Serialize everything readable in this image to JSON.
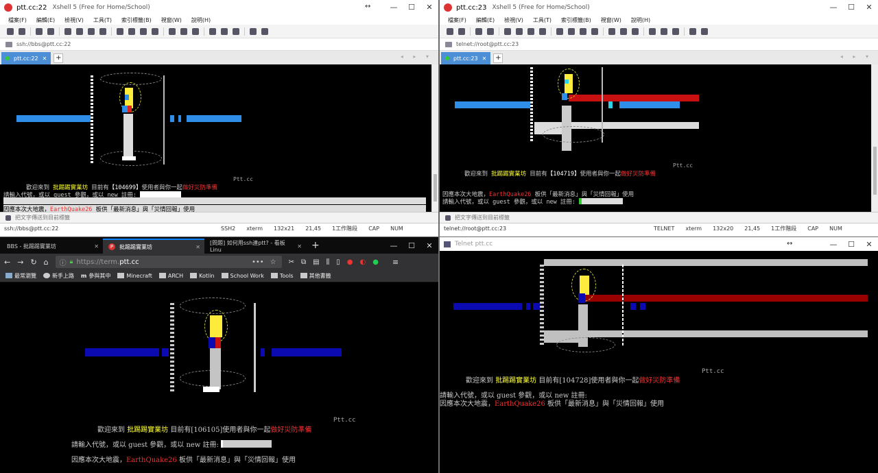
{
  "xshell": {
    "app_name": "Xshell 5 (Free for Home/School)",
    "menu": [
      "檔案(F)",
      "編輯(E)",
      "檢視(V)",
      "工具(T)",
      "索引標籤(B)",
      "視窗(W)",
      "說明(H)"
    ],
    "compose_placeholder": "把文字傳送到目前標籤",
    "left": {
      "title": "ptt.cc:22",
      "address": "ssh://bbs@ptt.cc:22",
      "tab": "ptt.cc:22",
      "welcome_pre": "歡迎來到",
      "site_name": "批踢踢實業坊",
      "welcome_mid": "目前有",
      "user_count": "【104699】",
      "welcome_post": "使用者與你一起",
      "disaster": "做好災防準備",
      "ptt_logo": "Ptt.cc",
      "login_prompt": "請輸入代號，或以 guest 參觀，或以 new 註冊:",
      "notice_pre": "因應本次大地震，",
      "quake_board": "EarthQuake26",
      "notice_post": "板供「最新消息」與「災情回報」使用",
      "status": {
        "addr": "ssh://bbs@ptt.cc:22",
        "proto": "SSH2",
        "term": "xterm",
        "size": "132x21",
        "pos": "21,45",
        "sessions": "1工作階段",
        "cap": "CAP",
        "num": "NUM"
      }
    },
    "right": {
      "title": "ptt.cc:23",
      "address": "telnet://root@ptt.cc:23",
      "tab": "ptt.cc:23",
      "welcome_pre": "歡迎來到",
      "site_name": "批踢踢實業坊",
      "welcome_mid": "目前有",
      "user_count": "【104719】",
      "welcome_post": "使用者與你一起",
      "disaster": "做好災防準備",
      "ptt_logo": "Ptt.cc",
      "notice_pre": "因應本次大地震，",
      "quake_board": "EarthQuake26",
      "notice_post": "板供「最新消息」與「災情回報」使用",
      "login_prompt": "請輸入代號，或以 guest 參觀，或以 new 註冊:",
      "status": {
        "addr": "telnet://root@ptt.cc:23",
        "proto": "TELNET",
        "term": "xterm",
        "size": "132x20",
        "pos": "21,45",
        "sessions": "1工作階段",
        "cap": "CAP",
        "num": "NUM"
      }
    }
  },
  "firefox": {
    "tabs": [
      {
        "label": "BBS - 批踢踢實業坊"
      },
      {
        "label": "批踢踢實業坊"
      },
      {
        "label": "[問題] 如何用ssh連ptt? - 看板 Linu"
      }
    ],
    "url_prefix": "https://term.",
    "url_host": "ptt.cc",
    "bookmarks": [
      "最常瀏覽",
      "新手上路",
      "參與其中",
      "Minecraft",
      "ARCH",
      "Kotlin",
      "School Work",
      "Tools",
      "其他書籤"
    ],
    "welcome_pre": "歡迎來到",
    "site_name": "批踢踢實業坊",
    "welcome_mid": "目前有",
    "user_count": "[106105]",
    "welcome_post": "使用者與你一起",
    "disaster": "做好災防準備",
    "ptt_logo": "Ptt.cc",
    "login_prompt": "請輸入代號，或以 guest 參觀，或以 new 註冊:",
    "notice_pre": "因應本次大地震，",
    "quake_board": "EarthQuake26",
    "notice_post": "板供「最新消息」與「災情回報」使用"
  },
  "telnet": {
    "title": "Telnet ptt.cc",
    "welcome_pre": "歡迎來到",
    "site_name": "批踢踢實業坊",
    "welcome_mid": "目前有",
    "user_count": "[104728]",
    "welcome_post": "使用者與你一起",
    "disaster": "做好災防準備",
    "ptt_logo": "Ptt.cc",
    "login_prompt": "請輸入代號，或以 guest 參觀，或以 new 註冊:",
    "notice_pre": "因應本次大地震，",
    "quake_board": "EarthQuake26",
    "notice_post": "板供「最新消息」與「災情回報」使用"
  }
}
